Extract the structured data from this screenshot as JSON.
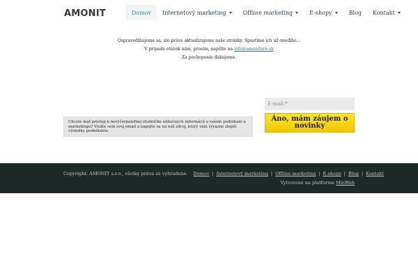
{
  "header": {
    "logo_text": "AMONIT"
  },
  "nav": {
    "items": [
      {
        "label": "Domov"
      },
      {
        "label": "Internetový marketing"
      },
      {
        "label": "Offline marketing"
      },
      {
        "label": "E-shopy"
      },
      {
        "label": "Blog"
      },
      {
        "label": "Kontakt"
      }
    ]
  },
  "notice": {
    "line1": "Ospravedlňujeme sa, ale práve aktualizujeme naše stránky. Spustíme ich už onedlho...",
    "line2_prefix": "V prípade otázok nám, prosím, napíšte na ",
    "line2_email": "info@amonitsro.sk",
    "line3": "Za pochopenie ďakujeme."
  },
  "promo": {
    "text": "Chcete mať prístup k nevyčerpateľnej studničke užitočných informácií o vašom podnikaní a marketingu? Vložte sem svoj email a napojte sa na náš zdroj, ktorý vám výrazne zlepší výsledky podnikania."
  },
  "subscribe": {
    "email_placeholder": "E-mail:*",
    "button_label": "Áno, mám záujem o novinky"
  },
  "footer": {
    "copyright": "Copyright: AMONIT s.r.o., všetky práva sú vyhradené.",
    "links": [
      {
        "label": "Domov"
      },
      {
        "label": "Internetový marketing"
      },
      {
        "label": "Offline marketing"
      },
      {
        "label": "E-shopy"
      },
      {
        "label": "Blog"
      },
      {
        "label": "Kontakt"
      }
    ],
    "separator": "|",
    "platform_prefix": "Vytvorené na platforme ",
    "platform_link": "MioWeb"
  },
  "colors": {
    "accent": "#3a8db0",
    "cta_yellow": "#ffe62a",
    "footer_bg": "#1d2a28"
  }
}
